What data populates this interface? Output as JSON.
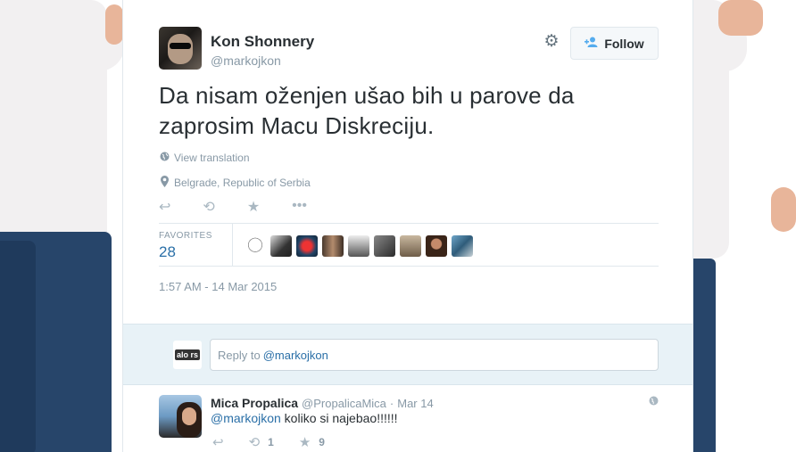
{
  "tweet": {
    "author_name": "Kon Shonnery",
    "author_handle": "@markojkon",
    "follow_label": "Follow",
    "text": "Da nisam oženjen ušao bih u parove da zaprosim Macu Diskreciju.",
    "view_translation": "View translation",
    "location": "Belgrade, Republic of Serbia",
    "favorites_label": "FAVORITES",
    "favorites_count": "28",
    "timestamp": "1:57 AM - 14 Mar 2015"
  },
  "reply_box": {
    "avatar_text": "alo rs",
    "prefix": "Reply to",
    "mention": "@markojkon"
  },
  "reply": {
    "author_name": "Mica Propalica",
    "author_handle": "@PropalicaMica",
    "separator": "·",
    "date": "Mar 14",
    "mention": "@markojkon",
    "text": " koliko si najebao!!!!!!",
    "retweet_count": "1",
    "favorite_count": "9"
  },
  "icons": {
    "gear": "gear-icon",
    "reply": "reply-icon",
    "retweet": "retweet-icon",
    "favorite": "star-icon",
    "more": "more-icon",
    "globe": "globe-icon",
    "location": "map-pin-icon"
  },
  "colors": {
    "link": "#2a6fa7",
    "muted": "#8899a6",
    "follow_icon": "#55acee",
    "reply_bg": "#e8f2f7"
  }
}
